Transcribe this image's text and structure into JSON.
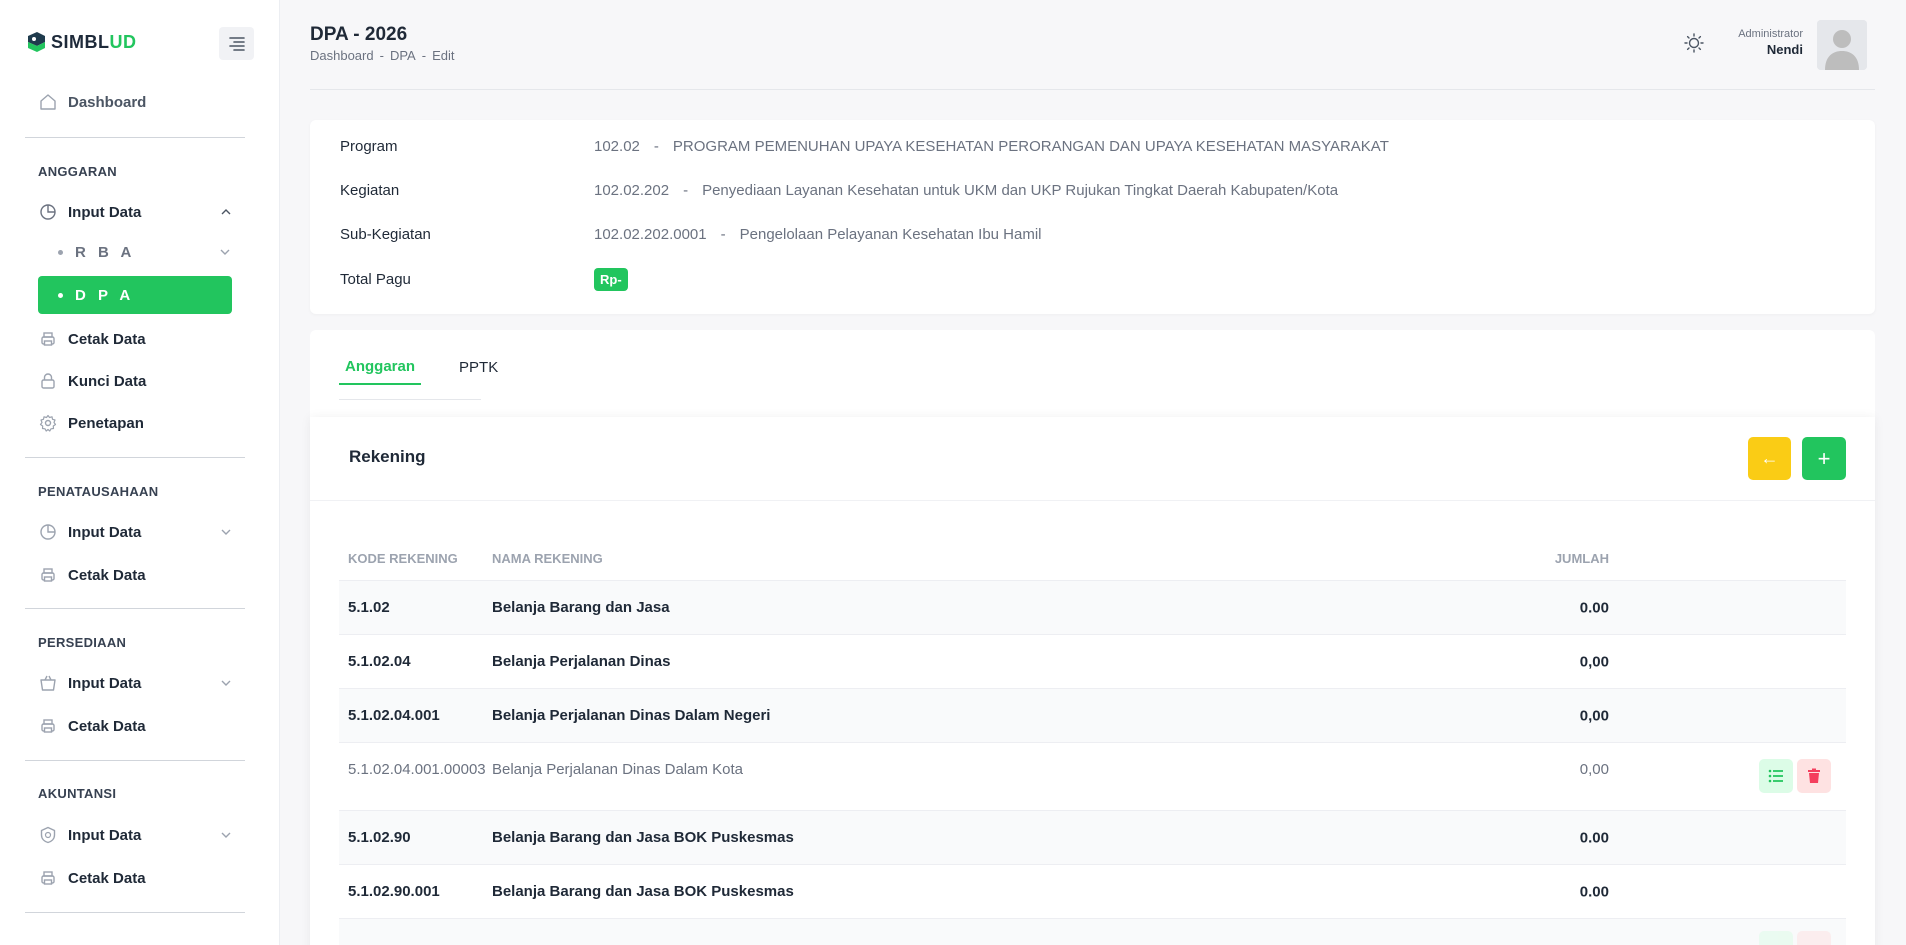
{
  "brand": {
    "name": "SIMBLUD"
  },
  "sidebar": {
    "dashboard": "Dashboard",
    "sections": {
      "anggaran": "ANGGARAN",
      "penatausahaan": "PENATAUSAHAAN",
      "persediaan": "PERSEDIAAN",
      "akuntansi": "AKUNTANSI"
    },
    "anggaran_items": {
      "input_data": "Input Data",
      "rba": "R B A",
      "dpa": "D P A",
      "cetak_data": "Cetak Data",
      "kunci_data": "Kunci Data",
      "penetapan": "Penetapan"
    },
    "penatausahaan_items": {
      "input_data": "Input Data",
      "cetak_data": "Cetak Data"
    },
    "persediaan_items": {
      "input_data": "Input Data",
      "cetak_data": "Cetak Data"
    },
    "akuntansi_items": {
      "input_data": "Input Data",
      "cetak_data": "Cetak Data"
    }
  },
  "header": {
    "title": "DPA - 2026",
    "breadcrumb": [
      "Dashboard",
      "-",
      "DPA",
      "-",
      "Edit"
    ],
    "user_role": "Administrator",
    "user_name": "Nendi"
  },
  "info": {
    "program_label": "Program",
    "program_code": "102.02",
    "program_sep": "-",
    "program_name": "PROGRAM PEMENUHAN UPAYA KESEHATAN PERORANGAN DAN UPAYA KESEHATAN MASYARAKAT",
    "kegiatan_label": "Kegiatan",
    "kegiatan_code": "102.02.202",
    "kegiatan_sep": "-",
    "kegiatan_name": "Penyediaan Layanan Kesehatan untuk UKM dan UKP Rujukan Tingkat Daerah Kabupaten/Kota",
    "subkegiatan_label": "Sub-Kegiatan",
    "subkegiatan_code": "102.02.202.0001",
    "subkegiatan_sep": "-",
    "subkegiatan_name": "Pengelolaan Pelayanan Kesehatan Ibu Hamil",
    "total_pagu_label": "Total Pagu",
    "total_pagu_value": "Rp-"
  },
  "tabs": [
    "Anggaran",
    "PPTK"
  ],
  "rekening": {
    "title": "Rekening",
    "back_label": "←",
    "add_label": "+",
    "columns": {
      "kode": "KODE REKENING",
      "nama": "NAMA REKENING",
      "jumlah": "JUMLAH"
    },
    "rows": [
      {
        "kode": "5.1.02",
        "nama": "Belanja Barang dan Jasa",
        "jumlah": "0.00"
      },
      {
        "kode": "5.1.02.04",
        "nama": "Belanja Perjalanan Dinas",
        "jumlah": "0,00"
      },
      {
        "kode": "5.1.02.04.001",
        "nama": "Belanja Perjalanan Dinas Dalam Negeri",
        "jumlah": "0,00"
      },
      {
        "kode": "5.1.02.04.001.00003",
        "nama": "Belanja Perjalanan Dinas Dalam Kota",
        "jumlah": "0,00"
      },
      {
        "kode": "5.1.02.90",
        "nama": "Belanja Barang dan Jasa BOK Puskesmas",
        "jumlah": "0.00"
      },
      {
        "kode": "5.1.02.90.001",
        "nama": "Belanja Barang dan Jasa BOK Puskesmas",
        "jumlah": "0.00"
      }
    ]
  },
  "colors": {
    "accent": "#22c55e",
    "warning": "#facc15",
    "danger": "#f43f5e"
  }
}
